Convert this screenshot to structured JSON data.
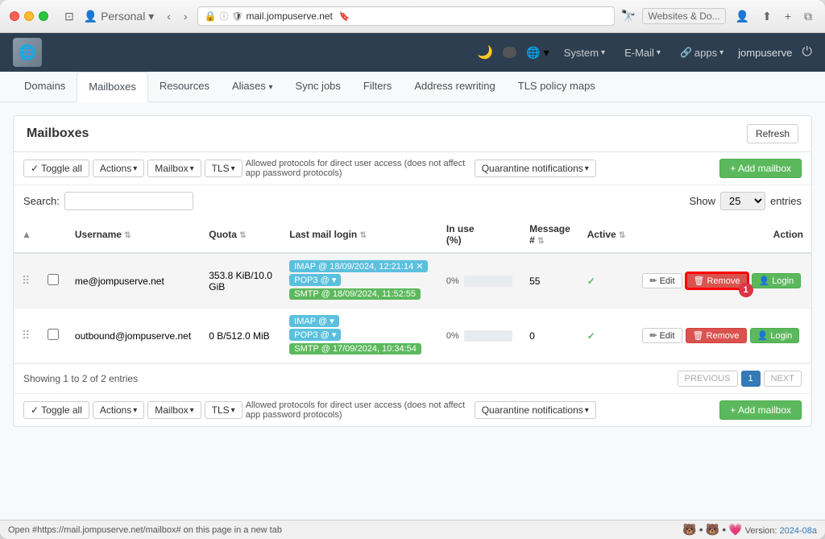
{
  "browser": {
    "tab_title": "mail.jompuserve.net",
    "address": "mail.jompuserve.net",
    "right_tab": "Websites & Do..."
  },
  "navbar": {
    "profile": "Personal",
    "system_label": "System",
    "system_caret": "▾",
    "email_label": "E-Mail",
    "email_caret": "▾",
    "apps_label": "apps",
    "apps_caret": "▾",
    "username": "jompuserve"
  },
  "tabs": [
    {
      "id": "domains",
      "label": "Domains",
      "active": false
    },
    {
      "id": "mailboxes",
      "label": "Mailboxes",
      "active": true
    },
    {
      "id": "resources",
      "label": "Resources",
      "active": false
    },
    {
      "id": "aliases",
      "label": "Aliases",
      "active": false
    },
    {
      "id": "sync-jobs",
      "label": "Sync jobs",
      "active": false
    },
    {
      "id": "filters",
      "label": "Filters",
      "active": false
    },
    {
      "id": "address-rewriting",
      "label": "Address rewriting",
      "active": false
    },
    {
      "id": "tls-policy-maps",
      "label": "TLS policy maps",
      "active": false
    }
  ],
  "panel": {
    "title": "Mailboxes",
    "refresh_label": "Refresh"
  },
  "toolbar_top": {
    "toggle_all": "✓ Toggle all",
    "actions_label": "Actions",
    "mailbox_label": "Mailbox",
    "tls_label": "TLS",
    "allowed_protocols": "Allowed protocols for direct user access (does not affect app password protocols)",
    "quarantine_label": "Quarantine notifications",
    "add_mailbox_label": "+ Add mailbox"
  },
  "toolbar_bottom": {
    "toggle_all": "✓ Toggle all",
    "actions_label": "Actions",
    "mailbox_label": "Mailbox",
    "tls_label": "TLS",
    "allowed_protocols": "Allowed protocols for direct user access (does not affect app password protocols)",
    "quarantine_label": "Quarantine notifications",
    "add_mailbox_label": "+ Add mailbox"
  },
  "search": {
    "label": "Search:",
    "placeholder": "",
    "show_label": "Show",
    "show_value": "25",
    "entries_label": "entries"
  },
  "table": {
    "columns": [
      "",
      "",
      "Username",
      "Quota",
      "Last mail login",
      "In use (%)",
      "Message #",
      "Active",
      "Action"
    ],
    "rows": [
      {
        "id": 1,
        "username": "me@jompuserve.net",
        "quota": "353.8 KiB/10.0 GiB",
        "protocols": [
          {
            "type": "IMAP",
            "label": "IMAP @ 18/09/2024, 12:21:14",
            "class": "imap"
          },
          {
            "type": "POP3",
            "label": "POP3 @ ▾",
            "class": "pop3"
          },
          {
            "type": "SMTP",
            "label": "SMTP @ 18/09/2024, 11:52:55",
            "class": "smtp"
          }
        ],
        "in_use_pct": 0,
        "in_use_label": "0%",
        "message_count": 55,
        "active": true,
        "highlighted": true
      },
      {
        "id": 2,
        "username": "outbound@jompuserve.net",
        "quota": "0 B/512.0 MiB",
        "protocols": [
          {
            "type": "IMAP",
            "label": "IMAP @ ▾",
            "class": "imap"
          },
          {
            "type": "POP3",
            "label": "POP3 @ ▾",
            "class": "pop3"
          },
          {
            "type": "SMTP",
            "label": "SMTP @ 17/09/2024, 10:34:54",
            "class": "smtp"
          }
        ],
        "in_use_pct": 0,
        "in_use_label": "0%",
        "message_count": 0,
        "active": true,
        "highlighted": false
      }
    ]
  },
  "footer": {
    "showing": "Showing 1 to 2 of 2 entries",
    "prev_label": "PREVIOUS",
    "page_num": "1",
    "next_label": "NEXT"
  },
  "action_buttons": {
    "edit_label": "✏ Edit",
    "remove_label": "🗑 Remove",
    "login_label": "👤 Login"
  },
  "status_bar": {
    "link_text": "Open #https://mail.jompuserve.net/mailbox# on this page in a new tab",
    "version_prefix": "Version:",
    "version": "2024-08a"
  }
}
